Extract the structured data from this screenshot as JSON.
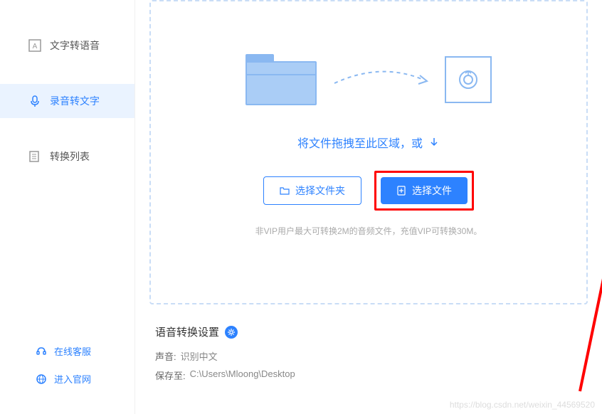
{
  "sidebar": {
    "items": [
      {
        "label": "文字转语音",
        "icon": "text-to-speech"
      },
      {
        "label": "录音转文字",
        "icon": "mic"
      },
      {
        "label": "转换列表",
        "icon": "list"
      }
    ],
    "footer": [
      {
        "label": "在线客服",
        "icon": "headset"
      },
      {
        "label": "进入官网",
        "icon": "globe"
      }
    ]
  },
  "dropzone": {
    "drag_text": "将文件拖拽至此区域，或",
    "select_folder_label": "选择文件夹",
    "select_file_label": "选择文件",
    "vip_note": "非VIP用户最大可转换2M的音频文件，充值VIP可转换30M。"
  },
  "settings": {
    "title": "语音转换设置",
    "voice_label": "声音:",
    "voice_value": "识别中文",
    "save_label": "保存至:",
    "save_value": "C:\\Users\\Mloong\\Desktop"
  },
  "watermark": "https://blog.csdn.net/weixin_44569520",
  "colors": {
    "primary": "#2d82ff",
    "highlight": "#ff0000"
  }
}
